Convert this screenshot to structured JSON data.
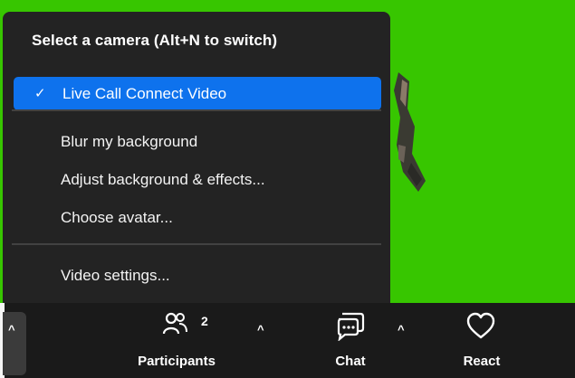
{
  "camera_menu": {
    "header": "Select a camera (Alt+N to switch)",
    "selected_camera": "Live Call Connect Video",
    "check_icon": "checkmark-icon",
    "items": [
      "Blur my background",
      "Adjust background & effects...",
      "Choose avatar..."
    ],
    "settings": "Video settings..."
  },
  "toolbar": {
    "participants_label": "Participants",
    "participants_count": "2",
    "chat_label": "Chat",
    "react_label": "React",
    "icons": [
      "participants-icon",
      "chat-icon",
      "heart-icon",
      "caret-up-icon"
    ]
  },
  "colors": {
    "video_background": "#37c600",
    "menu_background": "#232323",
    "selected_highlight": "#0e72ed",
    "toolbar_background": "#1a1a1a"
  }
}
